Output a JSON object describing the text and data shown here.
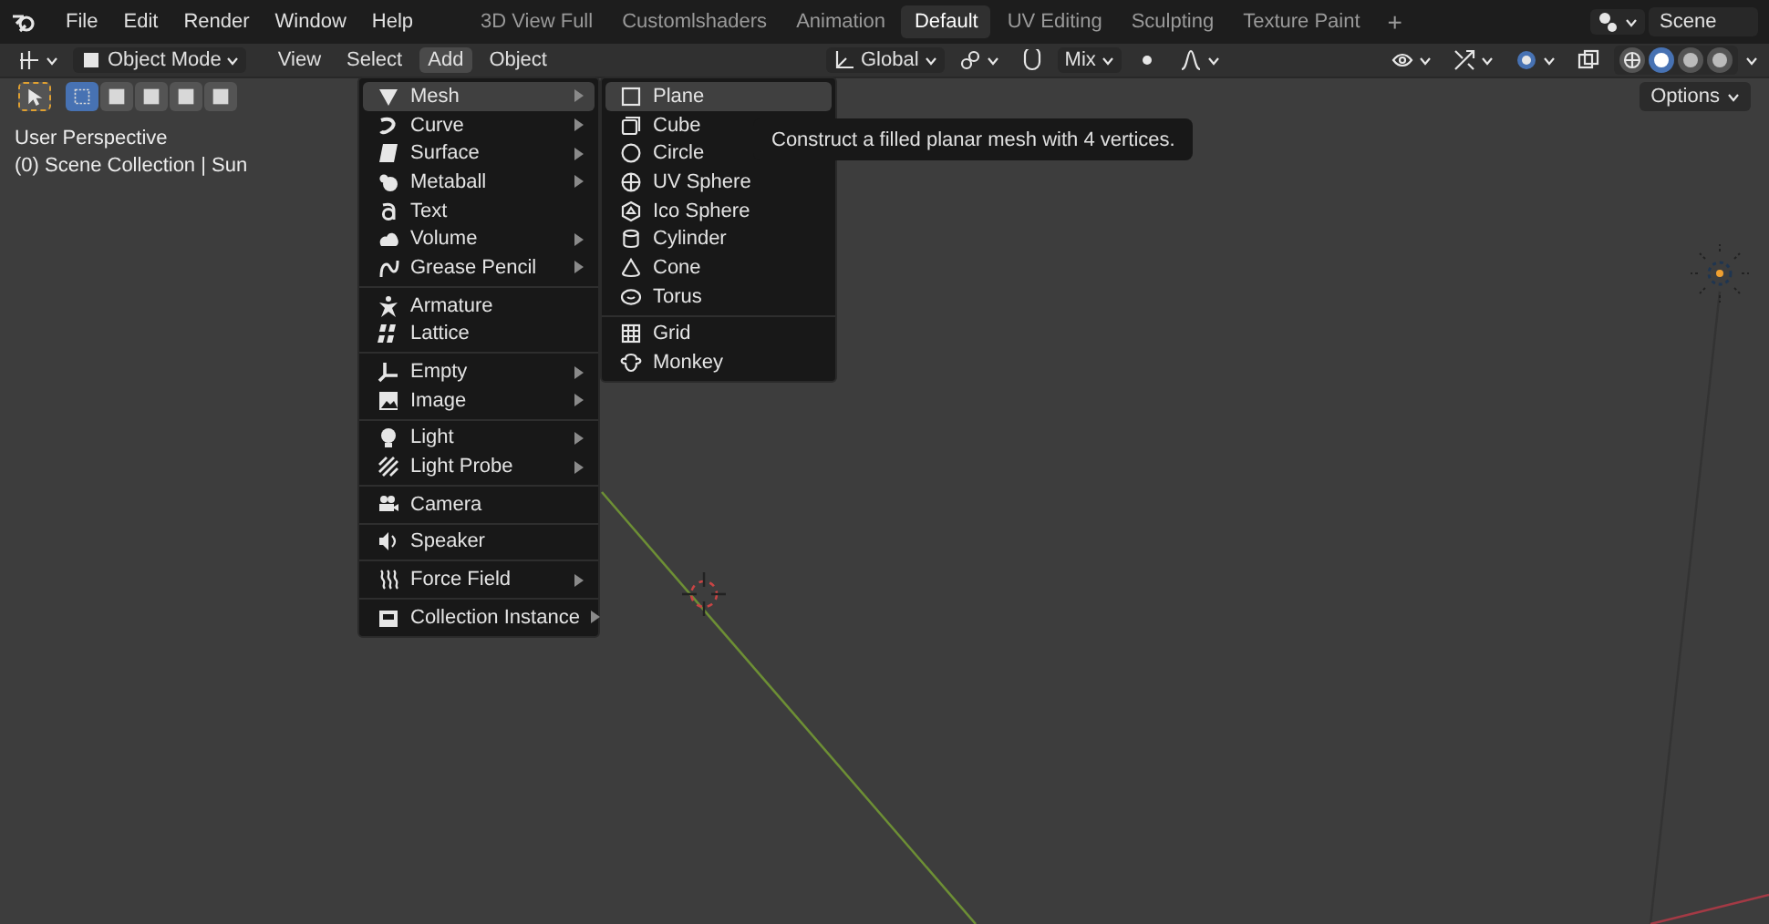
{
  "menubar": {
    "items": [
      "File",
      "Edit",
      "Render",
      "Window",
      "Help"
    ]
  },
  "workspaces": [
    {
      "label": "3D View Full",
      "selected": false
    },
    {
      "label": "Customlshaders",
      "selected": false
    },
    {
      "label": "Animation",
      "selected": false
    },
    {
      "label": "Default",
      "selected": true
    },
    {
      "label": "UV Editing",
      "selected": false
    },
    {
      "label": "Sculpting",
      "selected": false
    },
    {
      "label": "Texture Paint",
      "selected": false
    }
  ],
  "add_workspace": "+",
  "scene": {
    "value": "Scene"
  },
  "header": {
    "mode": "Object Mode",
    "menus": [
      {
        "label": "View",
        "selected": false
      },
      {
        "label": "Select",
        "selected": false
      },
      {
        "label": "Add",
        "selected": true
      },
      {
        "label": "Object",
        "selected": false
      }
    ],
    "orientation": "Global",
    "pivot": "Mix"
  },
  "select_modes": [
    {
      "selected": true
    },
    {
      "selected": false
    },
    {
      "selected": false
    },
    {
      "selected": false
    },
    {
      "selected": false
    }
  ],
  "shading": [
    {
      "selected": false
    },
    {
      "selected": true
    },
    {
      "selected": false
    },
    {
      "selected": false
    }
  ],
  "options": "Options",
  "viewport_info": [
    "User Perspective",
    "(0) Scene Collection | Sun"
  ],
  "add_menu": {
    "groups": [
      [
        {
          "label": "Mesh",
          "submenu": true,
          "selected": true
        },
        {
          "label": "Curve",
          "submenu": true,
          "selected": false
        },
        {
          "label": "Surface",
          "submenu": true,
          "selected": false
        },
        {
          "label": "Metaball",
          "submenu": true,
          "selected": false
        },
        {
          "label": "Text",
          "submenu": false,
          "selected": false
        },
        {
          "label": "Volume",
          "submenu": true,
          "selected": false
        },
        {
          "label": "Grease Pencil",
          "submenu": true,
          "selected": false
        }
      ],
      [
        {
          "label": "Armature",
          "submenu": false,
          "selected": false
        },
        {
          "label": "Lattice",
          "submenu": false,
          "selected": false
        }
      ],
      [
        {
          "label": "Empty",
          "submenu": true,
          "selected": false
        },
        {
          "label": "Image",
          "submenu": true,
          "selected": false
        }
      ],
      [
        {
          "label": "Light",
          "submenu": true,
          "selected": false
        },
        {
          "label": "Light Probe",
          "submenu": true,
          "selected": false
        }
      ],
      [
        {
          "label": "Camera",
          "submenu": false,
          "selected": false
        }
      ],
      [
        {
          "label": "Speaker",
          "submenu": false,
          "selected": false
        }
      ],
      [
        {
          "label": "Force Field",
          "submenu": true,
          "selected": false
        }
      ],
      [
        {
          "label": "Collection Instance",
          "submenu": true,
          "selected": false
        }
      ]
    ]
  },
  "mesh_menu": {
    "groups": [
      [
        {
          "label": "Plane",
          "selected": true
        },
        {
          "label": "Cube",
          "selected": false
        },
        {
          "label": "Circle",
          "selected": false
        },
        {
          "label": "UV Sphere",
          "selected": false
        },
        {
          "label": "Ico Sphere",
          "selected": false
        },
        {
          "label": "Cylinder",
          "selected": false
        },
        {
          "label": "Cone",
          "selected": false
        },
        {
          "label": "Torus",
          "selected": false
        }
      ],
      [
        {
          "label": "Grid",
          "selected": false
        },
        {
          "label": "Monkey",
          "selected": false
        }
      ]
    ]
  },
  "tooltip": "Construct a filled planar mesh with 4 vertices."
}
